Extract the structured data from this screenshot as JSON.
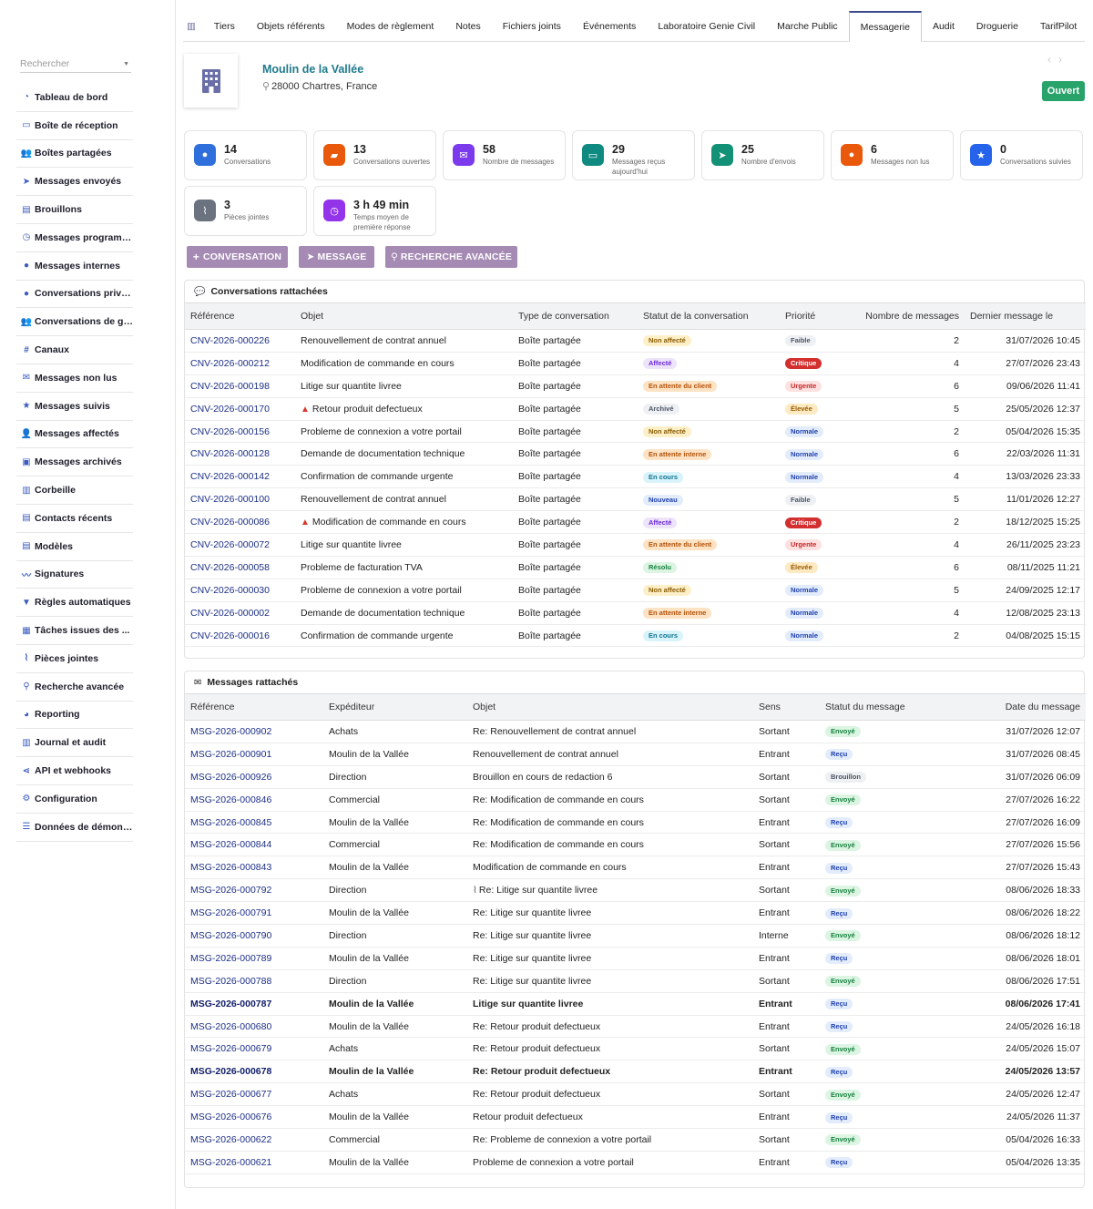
{
  "search": {
    "placeholder": "Rechercher"
  },
  "sidebar": [
    {
      "label": "Tableau de bord",
      "icon": "gauge"
    },
    {
      "label": "Boîte de réception",
      "icon": "inbox"
    },
    {
      "label": "Boîtes partagées",
      "icon": "users"
    },
    {
      "label": "Messages envoyés",
      "icon": "paper-plane"
    },
    {
      "label": "Brouillons",
      "icon": "file"
    },
    {
      "label": "Messages programm...",
      "icon": "clock"
    },
    {
      "label": "Messages internes",
      "icon": "comment"
    },
    {
      "label": "Conversations privées",
      "icon": "comments"
    },
    {
      "label": "Conversations de gr...",
      "icon": "users"
    },
    {
      "label": "Canaux",
      "icon": "hashtag"
    },
    {
      "label": "Messages non lus",
      "icon": "envelope"
    },
    {
      "label": "Messages suivis",
      "icon": "star"
    },
    {
      "label": "Messages affectés",
      "icon": "user-check"
    },
    {
      "label": "Messages archivés",
      "icon": "archive"
    },
    {
      "label": "Corbeille",
      "icon": "trash"
    },
    {
      "label": "Contacts récents",
      "icon": "address-book"
    },
    {
      "label": "Modèles",
      "icon": "file"
    },
    {
      "label": "Signatures",
      "icon": "signature"
    },
    {
      "label": "Règles automatiques",
      "icon": "filter"
    },
    {
      "label": "Tâches issues des ...",
      "icon": "calendar"
    },
    {
      "label": "Pièces jointes",
      "icon": "paperclip"
    },
    {
      "label": "Recherche avancée",
      "icon": "search"
    },
    {
      "label": "Reporting",
      "icon": "pie-chart"
    },
    {
      "label": "Journal et audit",
      "icon": "book"
    },
    {
      "label": "API et webhooks",
      "icon": "share"
    },
    {
      "label": "Configuration",
      "icon": "gear"
    },
    {
      "label": "Données de démons...",
      "icon": "database"
    }
  ],
  "tabs": [
    {
      "label": "",
      "icon": "building"
    },
    {
      "label": "Tiers"
    },
    {
      "label": "Objets référents"
    },
    {
      "label": "Modes de règlement"
    },
    {
      "label": "Notes"
    },
    {
      "label": "Fichiers joints"
    },
    {
      "label": "Événements"
    },
    {
      "label": "Laboratoire Genie Civil"
    },
    {
      "label": "Marche Public"
    },
    {
      "label": "Messagerie",
      "active": true
    },
    {
      "label": "Audit"
    },
    {
      "label": "Droguerie"
    },
    {
      "label": "TarifPilot"
    }
  ],
  "company": {
    "name": "Moulin de la Vallée",
    "address": "28000 Chartres, France",
    "status": "Ouvert"
  },
  "stats": [
    {
      "value": "14",
      "label": "Conversations",
      "color": "#2f6fdc",
      "icon": "comments"
    },
    {
      "value": "13",
      "label": "Conversations ouvertes",
      "color": "#e8590c",
      "icon": "folder-open"
    },
    {
      "value": "58",
      "label": "Nombre de messages",
      "color": "#7c3aed",
      "icon": "envelope"
    },
    {
      "value": "29",
      "label": "Messages reçus aujourd'hui",
      "color": "#0f8a80",
      "icon": "inbox"
    },
    {
      "value": "25",
      "label": "Nombre d'envois",
      "color": "#139177",
      "icon": "paper-plane"
    },
    {
      "value": "6",
      "label": "Messages non lus",
      "color": "#ea580c",
      "icon": "circle"
    },
    {
      "value": "0",
      "label": "Conversations suivies",
      "color": "#2563eb",
      "icon": "star"
    },
    {
      "value": "3",
      "label": "Pièces jointes",
      "color": "#6b7280",
      "icon": "paperclip"
    },
    {
      "value": "3 h 49 min",
      "label": "Temps moyen de première réponse",
      "color": "#9333ea",
      "icon": "stopwatch"
    }
  ],
  "actions": [
    "CONVERSATION",
    "MESSAGE",
    "RECHERCHE AVANCÉE"
  ],
  "badge_styles": {
    "Non affecté": {
      "bg": "#fdf0c9",
      "fg": "#8a5a00"
    },
    "Affecté": {
      "bg": "#ede4fb",
      "fg": "#6d28d9"
    },
    "En attente du client": {
      "bg": "#fde2c4",
      "fg": "#b45309"
    },
    "Archivé": {
      "bg": "#eef0f3",
      "fg": "#4b5563"
    },
    "En attente interne": {
      "bg": "#fde2c4",
      "fg": "#b45309"
    },
    "En cours": {
      "bg": "#d9f3fb",
      "fg": "#0e7490"
    },
    "Nouveau": {
      "bg": "#e3ecfb",
      "fg": "#1e40af"
    },
    "Résolu": {
      "bg": "#dcf5e3",
      "fg": "#15803d"
    },
    "Faible": {
      "bg": "#eef0f3",
      "fg": "#4b5563"
    },
    "Critique": {
      "bg": "#d32f2f",
      "fg": "#ffffff"
    },
    "Urgente": {
      "bg": "#fde0e0",
      "fg": "#c62828"
    },
    "Élevée": {
      "bg": "#fde9c2",
      "fg": "#9a5b00"
    },
    "Normale": {
      "bg": "#e3ecfb",
      "fg": "#1e40af"
    },
    "Envoyé": {
      "bg": "#dcf5e3",
      "fg": "#15803d"
    },
    "Reçu": {
      "bg": "#e3ecfb",
      "fg": "#1e40af"
    },
    "Brouillon": {
      "bg": "#eef0f3",
      "fg": "#4b5563"
    }
  },
  "conversations": {
    "title": "Conversations rattachées",
    "columns": [
      "Référence",
      "Objet",
      "Type de conversation",
      "Statut de la conversation",
      "Priorité",
      "Nombre de messages",
      "Dernier message le"
    ],
    "rows": [
      {
        "ref": "CNV-2026-000226",
        "objet": "Renouvellement de contrat annuel",
        "type": "Boîte partagée",
        "statut": "Non affecté",
        "priorite": "Faible",
        "nb": "2",
        "date": "31/07/2026 10:45"
      },
      {
        "ref": "CNV-2026-000212",
        "objet": "Modification de commande en cours",
        "type": "Boîte partagée",
        "statut": "Affecté",
        "priorite": "Critique",
        "nb": "4",
        "date": "27/07/2026 23:43"
      },
      {
        "ref": "CNV-2026-000198",
        "objet": "Litige sur quantite livree",
        "type": "Boîte partagée",
        "statut": "En attente du client",
        "priorite": "Urgente",
        "nb": "6",
        "date": "09/06/2026 11:41"
      },
      {
        "ref": "CNV-2026-000170",
        "objet": "Retour produit defectueux",
        "warn": true,
        "type": "Boîte partagée",
        "statut": "Archivé",
        "priorite": "Élevée",
        "nb": "5",
        "date": "25/05/2026 12:37"
      },
      {
        "ref": "CNV-2026-000156",
        "objet": "Probleme de connexion a votre portail",
        "type": "Boîte partagée",
        "statut": "Non affecté",
        "priorite": "Normale",
        "nb": "2",
        "date": "05/04/2026 15:35"
      },
      {
        "ref": "CNV-2026-000128",
        "objet": "Demande de documentation technique",
        "type": "Boîte partagée",
        "statut": "En attente interne",
        "priorite": "Normale",
        "nb": "6",
        "date": "22/03/2026 11:31"
      },
      {
        "ref": "CNV-2026-000142",
        "objet": "Confirmation de commande urgente",
        "type": "Boîte partagée",
        "statut": "En cours",
        "priorite": "Normale",
        "nb": "4",
        "date": "13/03/2026 23:33"
      },
      {
        "ref": "CNV-2026-000100",
        "objet": "Renouvellement de contrat annuel",
        "type": "Boîte partagée",
        "statut": "Nouveau",
        "priorite": "Faible",
        "nb": "5",
        "date": "11/01/2026 12:27"
      },
      {
        "ref": "CNV-2026-000086",
        "objet": "Modification de commande en cours",
        "warn": true,
        "type": "Boîte partagée",
        "statut": "Affecté",
        "priorite": "Critique",
        "nb": "2",
        "date": "18/12/2025 15:25"
      },
      {
        "ref": "CNV-2026-000072",
        "objet": "Litige sur quantite livree",
        "type": "Boîte partagée",
        "statut": "En attente du client",
        "priorite": "Urgente",
        "nb": "4",
        "date": "26/11/2025 23:23"
      },
      {
        "ref": "CNV-2026-000058",
        "objet": "Probleme de facturation TVA",
        "type": "Boîte partagée",
        "statut": "Résolu",
        "priorite": "Élevée",
        "nb": "6",
        "date": "08/11/2025 11:21"
      },
      {
        "ref": "CNV-2026-000030",
        "objet": "Probleme de connexion a votre portail",
        "type": "Boîte partagée",
        "statut": "Non affecté",
        "priorite": "Normale",
        "nb": "5",
        "date": "24/09/2025 12:17"
      },
      {
        "ref": "CNV-2026-000002",
        "objet": "Demande de documentation technique",
        "type": "Boîte partagée",
        "statut": "En attente interne",
        "priorite": "Normale",
        "nb": "4",
        "date": "12/08/2025 23:13"
      },
      {
        "ref": "CNV-2026-000016",
        "objet": "Confirmation de commande urgente",
        "type": "Boîte partagée",
        "statut": "En cours",
        "priorite": "Normale",
        "nb": "2",
        "date": "04/08/2025 15:15"
      }
    ]
  },
  "messages": {
    "title": "Messages rattachés",
    "columns": [
      "Référence",
      "Expéditeur",
      "Objet",
      "Sens",
      "Statut du message",
      "Date du message"
    ],
    "rows": [
      {
        "ref": "MSG-2026-000902",
        "exp": "Achats",
        "objet": "Re: Renouvellement de contrat annuel",
        "sens": "Sortant",
        "statut": "Envoyé",
        "date": "31/07/2026 12:07"
      },
      {
        "ref": "MSG-2026-000901",
        "exp": "Moulin de la Vallée",
        "objet": "Renouvellement de contrat annuel",
        "sens": "Entrant",
        "statut": "Reçu",
        "date": "31/07/2026 08:45"
      },
      {
        "ref": "MSG-2026-000926",
        "exp": "Direction",
        "objet": "Brouillon en cours de redaction 6",
        "sens": "Sortant",
        "statut": "Brouillon",
        "date": "31/07/2026 06:09"
      },
      {
        "ref": "MSG-2026-000846",
        "exp": "Commercial",
        "objet": "Re: Modification de commande en cours",
        "sens": "Sortant",
        "statut": "Envoyé",
        "date": "27/07/2026 16:22"
      },
      {
        "ref": "MSG-2026-000845",
        "exp": "Moulin de la Vallée",
        "objet": "Re: Modification de commande en cours",
        "sens": "Entrant",
        "statut": "Reçu",
        "date": "27/07/2026 16:09"
      },
      {
        "ref": "MSG-2026-000844",
        "exp": "Commercial",
        "objet": "Re: Modification de commande en cours",
        "sens": "Sortant",
        "statut": "Envoyé",
        "date": "27/07/2026 15:56"
      },
      {
        "ref": "MSG-2026-000843",
        "exp": "Moulin de la Vallée",
        "objet": "Modification de commande en cours",
        "sens": "Entrant",
        "statut": "Reçu",
        "date": "27/07/2026 15:43"
      },
      {
        "ref": "MSG-2026-000792",
        "exp": "Direction",
        "objet": "Re: Litige sur quantite livree",
        "clip": true,
        "sens": "Sortant",
        "statut": "Envoyé",
        "date": "08/06/2026 18:33"
      },
      {
        "ref": "MSG-2026-000791",
        "exp": "Moulin de la Vallée",
        "objet": "Re: Litige sur quantite livree",
        "sens": "Entrant",
        "statut": "Reçu",
        "date": "08/06/2026 18:22"
      },
      {
        "ref": "MSG-2026-000790",
        "exp": "Direction",
        "objet": "Re: Litige sur quantite livree",
        "sens": "Interne",
        "statut": "Envoyé",
        "date": "08/06/2026 18:12"
      },
      {
        "ref": "MSG-2026-000789",
        "exp": "Moulin de la Vallée",
        "objet": "Re: Litige sur quantite livree",
        "sens": "Entrant",
        "statut": "Reçu",
        "date": "08/06/2026 18:01"
      },
      {
        "ref": "MSG-2026-000788",
        "exp": "Direction",
        "objet": "Re: Litige sur quantite livree",
        "sens": "Sortant",
        "statut": "Envoyé",
        "date": "08/06/2026 17:51"
      },
      {
        "ref": "MSG-2026-000787",
        "exp": "Moulin de la Vallée",
        "objet": "Litige sur quantite livree",
        "sens": "Entrant",
        "statut": "Reçu",
        "date": "08/06/2026 17:41",
        "unread": true
      },
      {
        "ref": "MSG-2026-000680",
        "exp": "Moulin de la Vallée",
        "objet": "Re: Retour produit defectueux",
        "sens": "Entrant",
        "statut": "Reçu",
        "date": "24/05/2026 16:18"
      },
      {
        "ref": "MSG-2026-000679",
        "exp": "Achats",
        "objet": "Re: Retour produit defectueux",
        "sens": "Sortant",
        "statut": "Envoyé",
        "date": "24/05/2026 15:07"
      },
      {
        "ref": "MSG-2026-000678",
        "exp": "Moulin de la Vallée",
        "objet": "Re: Retour produit defectueux",
        "sens": "Entrant",
        "statut": "Reçu",
        "date": "24/05/2026 13:57",
        "unread": true
      },
      {
        "ref": "MSG-2026-000677",
        "exp": "Achats",
        "objet": "Re: Retour produit defectueux",
        "sens": "Sortant",
        "statut": "Envoyé",
        "date": "24/05/2026 12:47"
      },
      {
        "ref": "MSG-2026-000676",
        "exp": "Moulin de la Vallée",
        "objet": "Retour produit defectueux",
        "sens": "Entrant",
        "statut": "Reçu",
        "date": "24/05/2026 11:37"
      },
      {
        "ref": "MSG-2026-000622",
        "exp": "Commercial",
        "objet": "Re: Probleme de connexion a votre portail",
        "sens": "Sortant",
        "statut": "Envoyé",
        "date": "05/04/2026 16:33"
      },
      {
        "ref": "MSG-2026-000621",
        "exp": "Moulin de la Vallée",
        "objet": "Probleme de connexion a votre portail",
        "sens": "Entrant",
        "statut": "Reçu",
        "date": "05/04/2026 13:35"
      }
    ]
  }
}
